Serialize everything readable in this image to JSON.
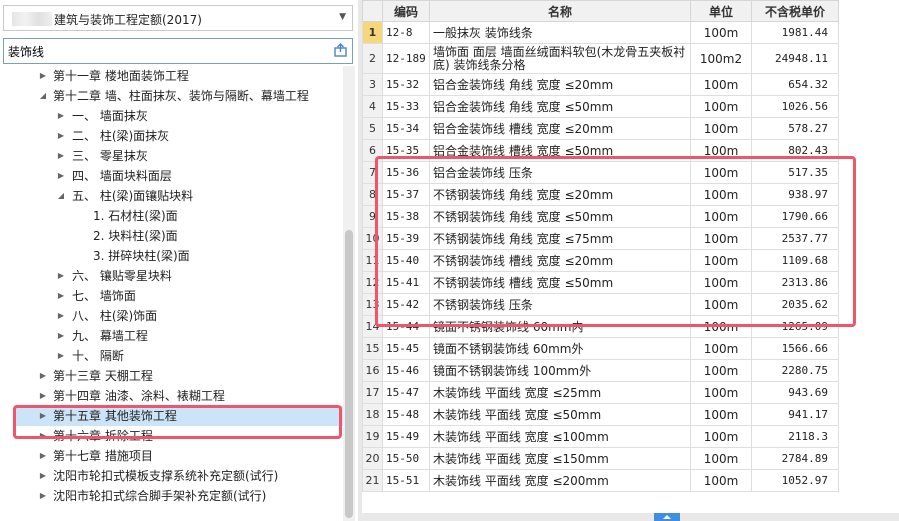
{
  "quota_select": {
    "value": "建筑与装饰工程定额(2017)"
  },
  "search": {
    "value": "装饰线"
  },
  "tree": [
    {
      "label": "第十一章 楼地面装饰工程",
      "level": 1,
      "expanded": false
    },
    {
      "label": "第十二章 墙、柱面抹灰、装饰与隔断、幕墙工程",
      "level": 1,
      "expanded": true
    },
    {
      "label": "一、 墙面抹灰",
      "level": 2,
      "expanded": false
    },
    {
      "label": "二、 柱(梁)面抹灰",
      "level": 2,
      "expanded": false
    },
    {
      "label": "三、 零星抹灰",
      "level": 2,
      "expanded": false
    },
    {
      "label": "四、 墙面块料面层",
      "level": 2,
      "expanded": false
    },
    {
      "label": "五、 柱(梁)面镶贴块料",
      "level": 2,
      "expanded": true
    },
    {
      "label": "1. 石材柱(梁)面",
      "level": 3,
      "leaf": true
    },
    {
      "label": "2. 块料柱(梁)面",
      "level": 3,
      "leaf": true
    },
    {
      "label": "3. 拼碎块柱(梁)面",
      "level": 3,
      "leaf": true
    },
    {
      "label": "六、 镶贴零星块料",
      "level": 2,
      "expanded": false
    },
    {
      "label": "七、 墙饰面",
      "level": 2,
      "expanded": false
    },
    {
      "label": "八、 柱(梁)饰面",
      "level": 2,
      "expanded": false
    },
    {
      "label": "九、 幕墙工程",
      "level": 2,
      "expanded": false
    },
    {
      "label": "十、 隔断",
      "level": 2,
      "expanded": false
    },
    {
      "label": "第十三章 天棚工程",
      "level": 1,
      "expanded": false
    },
    {
      "label": "第十四章 油漆、涂料、裱糊工程",
      "level": 1,
      "expanded": false
    },
    {
      "label": "第十五章 其他装饰工程",
      "level": 1,
      "expanded": false,
      "selected": true
    },
    {
      "label": "第十六章 拆除工程",
      "level": 1,
      "expanded": false
    },
    {
      "label": "第十七章 措施项目",
      "level": 1,
      "expanded": false
    },
    {
      "label": "沈阳市轮扣式模板支撑系统补充定额(试行)",
      "level": 1,
      "expanded": false
    },
    {
      "label": "沈阳市轮扣式综合脚手架补充定额(试行)",
      "level": 1,
      "expanded": false
    }
  ],
  "table": {
    "headers": {
      "code": "编码",
      "name": "名称",
      "unit": "单位",
      "price": "不含税单价"
    },
    "rows": [
      {
        "n": "1",
        "code": "12-8",
        "name": "一般抹灰 装饰线条",
        "unit": "100m",
        "price": "1981.44"
      },
      {
        "n": "2",
        "code": "12-189",
        "name": "墙饰面 面层 墙面丝绒面料软包(木龙骨五夹板衬底) 装饰线条分格",
        "unit": "100m2",
        "price": "24948.11"
      },
      {
        "n": "3",
        "code": "15-32",
        "name": "铝合金装饰线 角线 宽度 ≤20mm",
        "unit": "100m",
        "price": "654.32"
      },
      {
        "n": "4",
        "code": "15-33",
        "name": "铝合金装饰线 角线 宽度 ≤50mm",
        "unit": "100m",
        "price": "1026.56"
      },
      {
        "n": "5",
        "code": "15-34",
        "name": "铝合金装饰线 槽线 宽度 ≤20mm",
        "unit": "100m",
        "price": "578.27"
      },
      {
        "n": "6",
        "code": "15-35",
        "name": "铝合金装饰线 槽线 宽度 ≤50mm",
        "unit": "100m",
        "price": "802.43"
      },
      {
        "n": "7",
        "code": "15-36",
        "name": "铝合金装饰线 压条",
        "unit": "100m",
        "price": "517.35"
      },
      {
        "n": "8",
        "code": "15-37",
        "name": "不锈钢装饰线 角线 宽度 ≤20mm",
        "unit": "100m",
        "price": "938.97"
      },
      {
        "n": "9",
        "code": "15-38",
        "name": "不锈钢装饰线 角线 宽度 ≤50mm",
        "unit": "100m",
        "price": "1790.66"
      },
      {
        "n": "10",
        "code": "15-39",
        "name": "不锈钢装饰线 角线 宽度 ≤75mm",
        "unit": "100m",
        "price": "2537.77"
      },
      {
        "n": "11",
        "code": "15-40",
        "name": "不锈钢装饰线 槽线 宽度 ≤20mm",
        "unit": "100m",
        "price": "1109.68"
      },
      {
        "n": "12",
        "code": "15-41",
        "name": "不锈钢装饰线 槽线 宽度 ≤50mm",
        "unit": "100m",
        "price": "2313.86"
      },
      {
        "n": "13",
        "code": "15-42",
        "name": "不锈钢装饰线 压条",
        "unit": "100m",
        "price": "2035.62"
      },
      {
        "n": "14",
        "code": "15-44",
        "name": "镜面不锈钢装饰线 60mm内",
        "unit": "100m",
        "price": "1265.09"
      },
      {
        "n": "15",
        "code": "15-45",
        "name": "镜面不锈钢装饰线 60mm外",
        "unit": "100m",
        "price": "1566.66"
      },
      {
        "n": "16",
        "code": "15-46",
        "name": "镜面不锈钢装饰线 100mm外",
        "unit": "100m",
        "price": "2280.75"
      },
      {
        "n": "17",
        "code": "15-47",
        "name": "木装饰线 平面线 宽度 ≤25mm",
        "unit": "100m",
        "price": "943.69"
      },
      {
        "n": "18",
        "code": "15-48",
        "name": "木装饰线 平面线 宽度 ≤50mm",
        "unit": "100m",
        "price": "941.17"
      },
      {
        "n": "19",
        "code": "15-49",
        "name": "木装饰线 平面线 宽度 ≤100mm",
        "unit": "100m",
        "price": "2118.3"
      },
      {
        "n": "20",
        "code": "15-50",
        "name": "木装饰线 平面线 宽度 ≤150mm",
        "unit": "100m",
        "price": "2784.89"
      },
      {
        "n": "21",
        "code": "15-51",
        "name": "木装饰线 平面线 宽度 ≤200mm",
        "unit": "100m",
        "price": "1052.97"
      }
    ]
  },
  "colors": {
    "highlight": "#f0556c",
    "selected_row": "#cce4f7",
    "first_row_marker": "#f7d77c"
  }
}
